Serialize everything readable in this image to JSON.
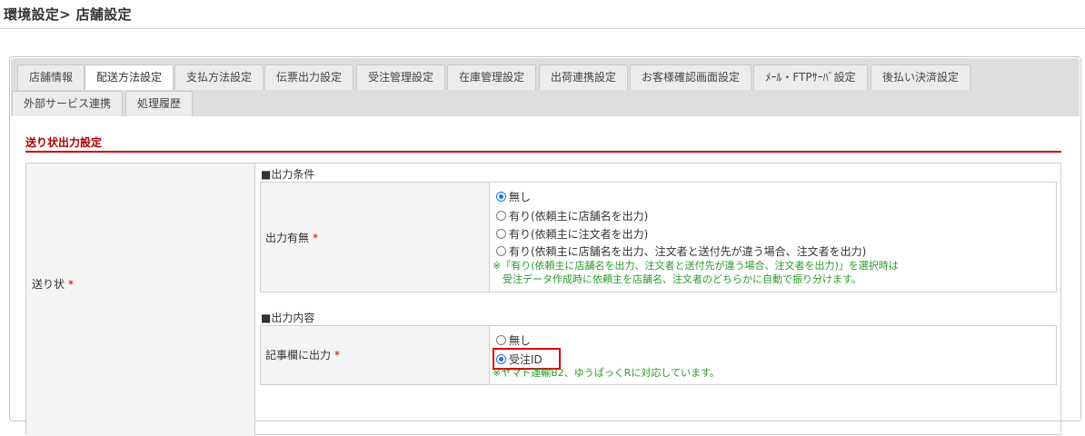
{
  "page": {
    "title": "環境設定> 店舗設定"
  },
  "tabs": [
    "店舗情報",
    "配送方法設定",
    "支払方法設定",
    "伝票出力設定",
    "受注管理設定",
    "在庫管理設定",
    "出荷連携設定",
    "お客様確認画面設定",
    "ﾒｰﾙ・FTPｻｰﾊﾞ設定",
    "後払い決済設定",
    "外部サービス連携",
    "処理履歴"
  ],
  "section": {
    "title": "送り状出力設定"
  },
  "row": {
    "label": "送り状",
    "required_mark": "*",
    "conditions": {
      "heading": "■出力条件",
      "field_label": "出力有無",
      "options": [
        "無し",
        "有り(依頼主に店舗名を出力)",
        "有り(依頼主に注文者を出力)",
        "有り(依頼主に店舗名を出力、注文者と送付先が違う場合、注文者を出力)"
      ],
      "selected_index": 0,
      "note_line1": "※「有り(依頼主に店舗名を出力、注文者と送付先が違う場合、注文者を出力)」を選択時は",
      "note_line2": "受注データ作成時に依頼主を店舗名、注文者のどちらかに自動で振り分けます。"
    },
    "content": {
      "heading": "■出力内容",
      "field_label": "記事欄に出力",
      "options": [
        "無し",
        "受注ID"
      ],
      "selected_index": 1,
      "note": "※ヤマト運輸B2、ゆうぱっくRに対応しています。"
    }
  },
  "colors": {
    "accent_red": "#cc0000",
    "radio_blue": "#1a73e8",
    "note_green": "#2a9a2a"
  }
}
